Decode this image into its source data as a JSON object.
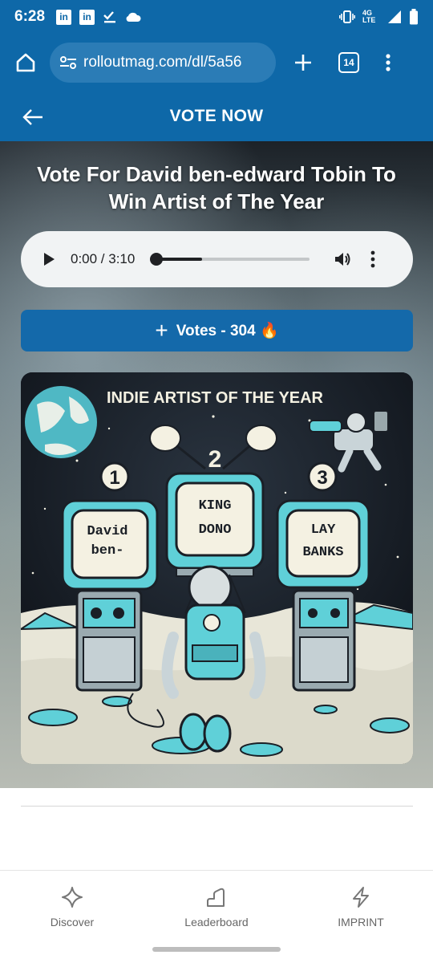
{
  "status_bar": {
    "time": "6:28",
    "network_label": "4G LTE"
  },
  "browser": {
    "url": "rolloutmag.com/dl/5a56",
    "tab_count": "14"
  },
  "header": {
    "title": "VOTE NOW"
  },
  "hero": {
    "title": "Vote For David ben-edward Tobin To Win Artist of The Year",
    "audio": {
      "time": "0:00 / 3:10",
      "progress_fraction": 0.3
    },
    "vote_button": {
      "label": "Votes - 304 🔥"
    }
  },
  "artwork": {
    "banner": "INDIE ARTIST OF THE YEAR",
    "tv1": {
      "number": "1",
      "name_line1": "David",
      "name_line2": "ben-"
    },
    "tv2": {
      "number": "2",
      "name_line1": "KING",
      "name_line2": "DONO"
    },
    "tv3": {
      "number": "3",
      "name_line1": "LAY",
      "name_line2": "BANKS"
    }
  },
  "bottom_nav": [
    {
      "label": "Discover",
      "icon": "sparkle-icon"
    },
    {
      "label": "Leaderboard",
      "icon": "stairs-icon"
    },
    {
      "label": "IMPRINT",
      "icon": "lightning-icon"
    }
  ],
  "colors": {
    "primary": "#0e68a8",
    "button": "#1469aa",
    "accent_cyan": "#5fd0d8"
  }
}
